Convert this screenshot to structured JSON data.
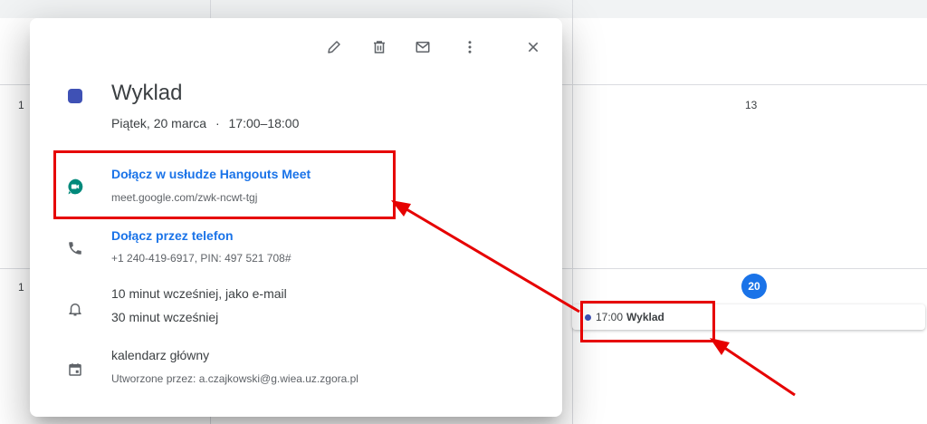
{
  "calendar": {
    "day_13": "13",
    "day_20": "20",
    "left_edge_1": "1",
    "left_edge_2": "1",
    "event_time": "17:00",
    "event_title": "Wyklad",
    "event_color": "#3f51b5",
    "today_color": "#1a73e8"
  },
  "popup": {
    "toolbar": {
      "edit_icon": "pencil-icon",
      "delete_icon": "trash-icon",
      "email_icon": "envelope-icon",
      "more_icon": "more-vert-icon",
      "close_icon": "close-icon"
    },
    "title": "Wyklad",
    "date_text": "Piątek, 20 marca",
    "separator": "·",
    "time_text": "17:00–18:00",
    "meet": {
      "label": "Dołącz w usłudze Hangouts Meet",
      "url": "meet.google.com/zwk-ncwt-tgj"
    },
    "phone": {
      "label": "Dołącz przez telefon",
      "details": "+1 240-419-6917, PIN: 497 521 708#"
    },
    "notifications": [
      "10 minut wcześniej, jako e-mail",
      "30 minut wcześniej"
    ],
    "calendar_name": "kalendarz główny",
    "created_by": "Utworzone przez: a.czajkowski@g.wiea.uz.zgora.pl",
    "link_color": "#1a73e8"
  },
  "annotations": {
    "color": "#e60000"
  }
}
